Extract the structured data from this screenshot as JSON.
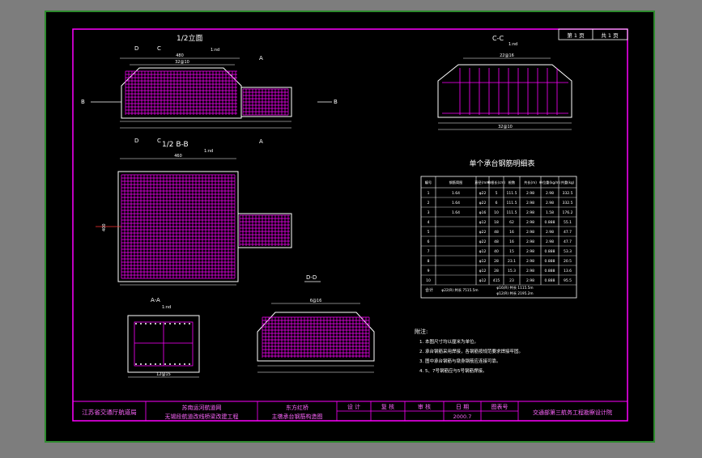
{
  "colors": {
    "background": "#7d7d7d",
    "canvas": "#000000",
    "canvas_border": "#30a030",
    "frame": "#ff00ff",
    "rebar": "#ff00ff",
    "line": "#ffffff",
    "text": "#ffffff"
  },
  "sheet": {
    "page_label": "第 1 页",
    "total_label": "共 1 页"
  },
  "views": {
    "half_elevation": "1/2立面",
    "half_section_bb": "1/2 B-B",
    "section_cc": "C-C",
    "section_aa": "A-A",
    "section_dd": "D-D",
    "scale_note": "1:nd",
    "marks": {
      "b": "B",
      "d": "D",
      "c": "C",
      "a": "A"
    }
  },
  "dims": {
    "top_total": "480",
    "top_sub": "420",
    "top_bar": "32@10",
    "plan_total": "460",
    "side_height": "400",
    "cc_top": "22@16",
    "cc_bottom": "32@10",
    "aa_bottom": "12@15",
    "dd_top": "6@16"
  },
  "table": {
    "title": "单个承台钢筋明细表",
    "headers": [
      "编号",
      "钢筋简图",
      "直径(mm)",
      "单根长(cm)",
      "根数",
      "共长(m)",
      "单位重(kg/m)",
      "共重(kg)"
    ],
    "rows": [
      {
        "no": "1",
        "sketch": "1.64",
        "dia": "φ22",
        "len": "5",
        "count": "111.5",
        "total": "2.98",
        "unit": "2.98",
        "weight": "332.5"
      },
      {
        "no": "2",
        "sketch": "1.64",
        "dia": "φ22",
        "len": "6",
        "count": "111.5",
        "total": "2.98",
        "unit": "2.98",
        "weight": "332.5"
      },
      {
        "no": "3",
        "sketch": "1.64",
        "dia": "φ16",
        "len": "10",
        "count": "111.5",
        "total": "2.98",
        "unit": "1.58",
        "weight": "176.2"
      },
      {
        "no": "4",
        "sketch": "",
        "dia": "φ12",
        "len": "18",
        "count": "62",
        "total": "2.98",
        "unit": "0.888",
        "weight": "55.1"
      },
      {
        "no": "5",
        "sketch": "",
        "dia": "φ22",
        "len": "48",
        "count": "16",
        "total": "2.98",
        "unit": "2.98",
        "weight": "47.7"
      },
      {
        "no": "6",
        "sketch": "",
        "dia": "φ22",
        "len": "48",
        "count": "16",
        "total": "2.98",
        "unit": "2.98",
        "weight": "47.7"
      },
      {
        "no": "7",
        "sketch": "",
        "dia": "φ12",
        "len": "40",
        "count": "15",
        "total": "2.98",
        "unit": "0.888",
        "weight": "53.3"
      },
      {
        "no": "8",
        "sketch": "",
        "dia": "φ12",
        "len": "28",
        "count": "23.1",
        "total": "2.98",
        "unit": "0.888",
        "weight": "20.5"
      },
      {
        "no": "9",
        "sketch": "",
        "dia": "φ12",
        "len": "28",
        "count": "15.3",
        "total": "2.98",
        "unit": "0.888",
        "weight": "13.6"
      },
      {
        "no": "10",
        "sketch": "",
        "dia": "φ12",
        "len": "415",
        "count": "23",
        "total": "2.98",
        "unit": "0.888",
        "weight": "95.5"
      }
    ],
    "summary": [
      "合计",
      "φ22(R)  共长 7515.5m",
      "φ16(R)  共长 1115.5m",
      "φ12(R)  共长 2195.2m"
    ]
  },
  "notes": {
    "heading": "附注:",
    "items": [
      "1. 本图尺寸均以厘米为单位。",
      "2. 承台钢筋采用焊接，各钢筋按规范要求焊接牢固。",
      "3. 图中承台钢筋与墩身钢筋应连接可靠。",
      "4. 5、7号钢筋应与5号钢筋焊接。"
    ]
  },
  "title_block": {
    "org": "江苏省交通厅航道局",
    "project_line1": "苏南运河航道网",
    "project_line2": "无锡段航道改线桥梁改建工程",
    "bridge_name": "东方红桥",
    "drawing_name": "主墩承台钢筋构造图",
    "design": "设 计",
    "check": "复 核",
    "review": "审 核",
    "date_label": "日 期",
    "date": "2000.7",
    "drawing_no_label": "图表号",
    "design_institute": "交通部第三航务工程勘察设计院"
  }
}
